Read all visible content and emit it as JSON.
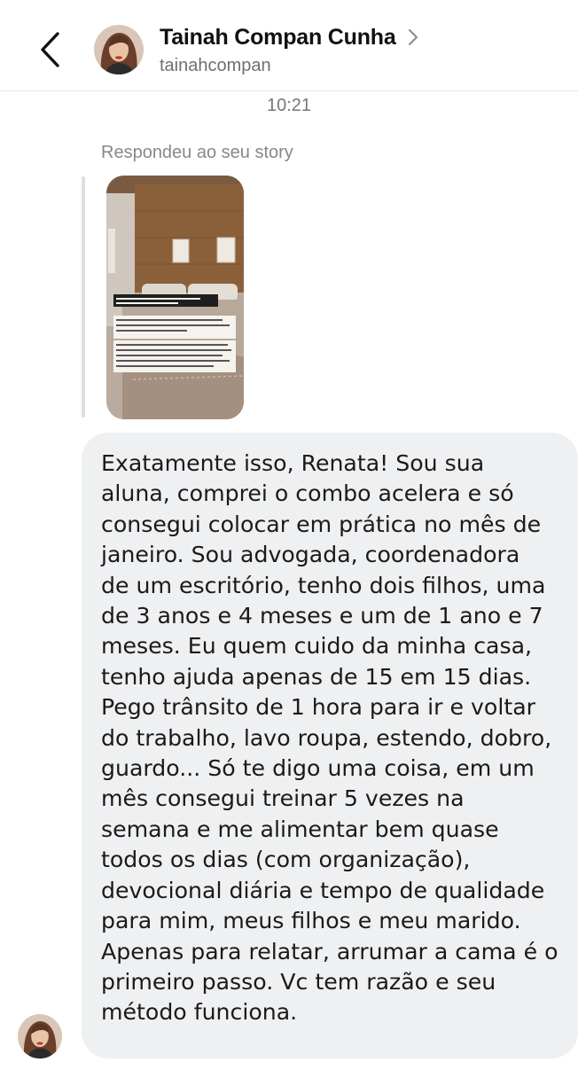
{
  "header": {
    "back_icon": "chevron-left-icon",
    "contact_name": "Tainah Compan Cunha",
    "username": "tainahcompan",
    "chevron_icon": "chevron-right-icon"
  },
  "conversation": {
    "timestamp": "10:21",
    "reply_label": "Respondeu ao seu story",
    "story": {
      "text_1": "\"Só\" arrumar a cama pode parecer um esforço desnecessário neste momento...",
      "text_2": "Mas é impressionante o poder disso. A sensação de produtividade e de paz na vida, é quase que instantâneo.",
      "text_3": "As vezes a gente fica achando que nem vale a pena fazer algo, pq o resto tá todo CAÓTICO. Mas a verdade é que um pouquinho de ORDEM, SEMPRE vai nos fazer muito bem!"
    },
    "message": "Exatamente isso, Renata! Sou sua\naluna, comprei o combo acelera e só\nconsegui colocar em prática no mês de\njaneiro. Sou advogada, coordenadora\nde um escritório, tenho dois filhos, uma\nde 3 anos e 4 meses e um de 1 ano e 7\nmeses. Eu quem cuido da minha casa,\ntenho ajuda apenas de 15 em 15 dias.\nPego trânsito de 1 hora para ir e voltar\ndo trabalho, lavo roupa, estendo, dobro,\nguardo... Só te digo uma coisa, em um\nmês consegui treinar 5 vezes na\nsemana e me alimentar bem quase\ntodos os dias (com organização),\ndevocional diária e tempo de qualidade\npara mim, meus filhos e meu marido.\nApenas para relatar, arrumar a cama é o\nprimeiro passo. Vc tem razão e seu\nmétodo funciona."
  },
  "colors": {
    "bubble_bg": "#eff0f2",
    "text_primary": "#111111",
    "text_secondary": "#6f6f6f",
    "divider": "#e6e6e6"
  }
}
